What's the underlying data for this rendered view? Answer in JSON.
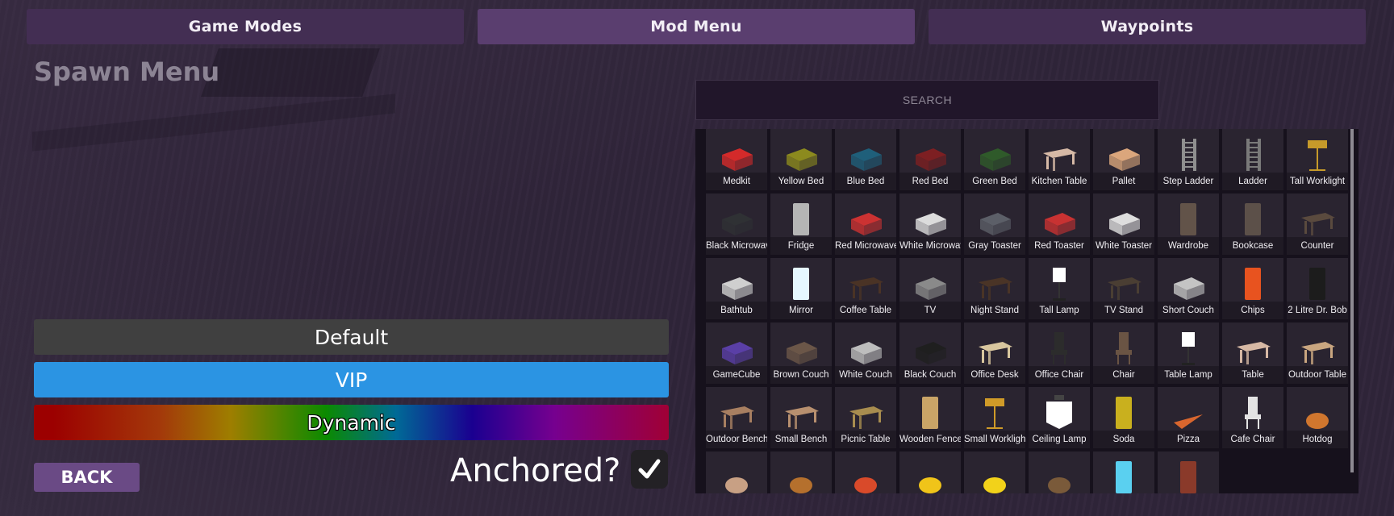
{
  "tabs": [
    {
      "label": "Game Modes",
      "active": false
    },
    {
      "label": "Mod Menu",
      "active": true
    },
    {
      "label": "Waypoints",
      "active": false
    }
  ],
  "title": "Spawn Menu",
  "search": {
    "placeholder": "SEARCH",
    "value": ""
  },
  "items": [
    {
      "label": "Medkit",
      "icon": "medkit-icon",
      "color": "#d42a2a"
    },
    {
      "label": "Yellow Bed",
      "icon": "bed-icon",
      "color": "#8c8a1e"
    },
    {
      "label": "Blue Bed",
      "icon": "bed-icon",
      "color": "#1f5f7a"
    },
    {
      "label": "Red Bed",
      "icon": "bed-icon",
      "color": "#7d1f22"
    },
    {
      "label": "Green Bed",
      "icon": "bed-icon",
      "color": "#2f5a2a"
    },
    {
      "label": "Kitchen Table",
      "icon": "table-icon",
      "color": "#d6b9a6"
    },
    {
      "label": "Pallet",
      "icon": "pallet-icon",
      "color": "#dba67c"
    },
    {
      "label": "Step Ladder",
      "icon": "ladder-icon",
      "color": "#8f8f8f"
    },
    {
      "label": "Ladder",
      "icon": "ladder-icon",
      "color": "#7a7a7a"
    },
    {
      "label": "Tall Worklight",
      "icon": "worklight-icon",
      "color": "#c69a2a"
    },
    {
      "label": "Black Microwave",
      "icon": "microwave-icon",
      "color": "#2f3134"
    },
    {
      "label": "Fridge",
      "icon": "fridge-icon",
      "color": "#b5b5b5"
    },
    {
      "label": "Red Microwave",
      "icon": "microwave-icon",
      "color": "#cc3232"
    },
    {
      "label": "White Microwave",
      "icon": "microwave-icon",
      "color": "#dcdcdc"
    },
    {
      "label": "Gray Toaster",
      "icon": "toaster-icon",
      "color": "#5c5f68"
    },
    {
      "label": "Red Toaster",
      "icon": "toaster-icon",
      "color": "#c83232"
    },
    {
      "label": "White Toaster",
      "icon": "toaster-icon",
      "color": "#dedede"
    },
    {
      "label": "Wardrobe",
      "icon": "wardrobe-icon",
      "color": "#625349"
    },
    {
      "label": "Bookcase",
      "icon": "bookcase-icon",
      "color": "#5c5049"
    },
    {
      "label": "Counter",
      "icon": "counter-icon",
      "color": "#5a4a3e"
    },
    {
      "label": "Bathtub",
      "icon": "bathtub-icon",
      "color": "#cfcfcf"
    },
    {
      "label": "Mirror",
      "icon": "mirror-icon",
      "color": "#e6f8ff"
    },
    {
      "label": "Coffee Table",
      "icon": "table-icon",
      "color": "#4a3325"
    },
    {
      "label": "TV",
      "icon": "tv-icon",
      "color": "#8a8a8a"
    },
    {
      "label": "Night Stand",
      "icon": "nightstand-icon",
      "color": "#4a3426"
    },
    {
      "label": "Tall Lamp",
      "icon": "lamp-icon",
      "color": "#ffffff"
    },
    {
      "label": "TV Stand",
      "icon": "tvstand-icon",
      "color": "#4a3e33"
    },
    {
      "label": "Short Couch",
      "icon": "couch-icon",
      "color": "#c4c4c4"
    },
    {
      "label": "Chips",
      "icon": "chips-icon",
      "color": "#e8531f"
    },
    {
      "label": "2 Litre Dr. Bob",
      "icon": "bottle-icon",
      "color": "#1c1c1c"
    },
    {
      "label": "GameCube",
      "icon": "gamecube-icon",
      "color": "#5a3fa6"
    },
    {
      "label": "Brown Couch",
      "icon": "couch-icon",
      "color": "#6b5648"
    },
    {
      "label": "White Couch",
      "icon": "couch-icon",
      "color": "#bdbdbd"
    },
    {
      "label": "Black Couch",
      "icon": "couch-icon",
      "color": "#1f1f1f"
    },
    {
      "label": "Office Desk",
      "icon": "desk-icon",
      "color": "#d8c69e"
    },
    {
      "label": "Office Chair",
      "icon": "chair-icon",
      "color": "#2c2c2c"
    },
    {
      "label": "Chair",
      "icon": "chair-icon",
      "color": "#6a5444"
    },
    {
      "label": "Table Lamp",
      "icon": "lamp-icon",
      "color": "#ffffff"
    },
    {
      "label": "Table",
      "icon": "table-icon",
      "color": "#d6b8a4"
    },
    {
      "label": "Outdoor Table",
      "icon": "table-icon",
      "color": "#c9a680"
    },
    {
      "label": "Outdoor Bench",
      "icon": "bench-icon",
      "color": "#a87f61"
    },
    {
      "label": "Small Bench",
      "icon": "bench-icon",
      "color": "#b8906f"
    },
    {
      "label": "Picnic Table",
      "icon": "picnic-table-icon",
      "color": "#a88d4f"
    },
    {
      "label": "Wooden Fence",
      "icon": "fence-icon",
      "color": "#c9a467"
    },
    {
      "label": "Small Worklight",
      "icon": "worklight-icon",
      "color": "#d09b28"
    },
    {
      "label": "Ceiling Lamp",
      "icon": "ceiling-lamp-icon",
      "color": "#ffffff"
    },
    {
      "label": "Soda",
      "icon": "soda-icon",
      "color": "#c9b01e"
    },
    {
      "label": "Pizza",
      "icon": "pizza-icon",
      "color": "#d9662e"
    },
    {
      "label": "Cafe Chair",
      "icon": "chair-icon",
      "color": "#e3e3e3"
    },
    {
      "label": "Hotdog",
      "icon": "hotdog-icon",
      "color": "#d0762e"
    },
    {
      "label": "",
      "icon": "donut-icon",
      "color": "#c8a084"
    },
    {
      "label": "",
      "icon": "burger-icon",
      "color": "#b5702d"
    },
    {
      "label": "",
      "icon": "apple-icon",
      "color": "#d94a2a"
    },
    {
      "label": "",
      "icon": "banana-icon",
      "color": "#f0c419"
    },
    {
      "label": "",
      "icon": "lemon-icon",
      "color": "#f2d21a"
    },
    {
      "label": "",
      "icon": "food-plate-icon",
      "color": "#7a5a3a"
    },
    {
      "label": "",
      "icon": "water-bottle-icon",
      "color": "#5ad0f0"
    },
    {
      "label": "",
      "icon": "can-icon",
      "color": "#8a3a2a"
    }
  ],
  "modes": {
    "default": "Default",
    "vip": "VIP",
    "dynamic": "Dynamic"
  },
  "back_label": "BACK",
  "anchored": {
    "label": "Anchored?",
    "checked": true
  }
}
